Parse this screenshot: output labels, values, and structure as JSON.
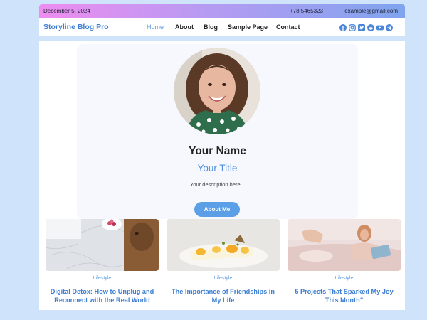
{
  "topbar": {
    "date": "December 5, 2024",
    "phone": "+78 5465323",
    "email": "example@gmail.com"
  },
  "brand": "Storyline Blog Pro",
  "nav": [
    {
      "label": "Home",
      "active": true
    },
    {
      "label": "About"
    },
    {
      "label": "Blog"
    },
    {
      "label": "Sample Page"
    },
    {
      "label": "Contact"
    }
  ],
  "social_icons": [
    "facebook-icon",
    "instagram-icon",
    "twitter-icon",
    "reddit-icon",
    "youtube-icon",
    "telegram-icon"
  ],
  "profile": {
    "name": "Your Name",
    "title": "Your Title",
    "description": "Your description here...",
    "button": "About Me"
  },
  "posts": [
    {
      "category": "Lifestyle",
      "title": "Digital Detox: How to Unplug and Reconnect with the Real World"
    },
    {
      "category": "Lifestyle",
      "title": "The Importance of Friendships in My Life"
    },
    {
      "category": "Lifestyle",
      "title": "5 Projects That Sparked My Joy This Month”"
    }
  ],
  "colors": {
    "accent": "#5b9de5",
    "brand": "#3d7ed2",
    "background": "#cfe3fb"
  }
}
